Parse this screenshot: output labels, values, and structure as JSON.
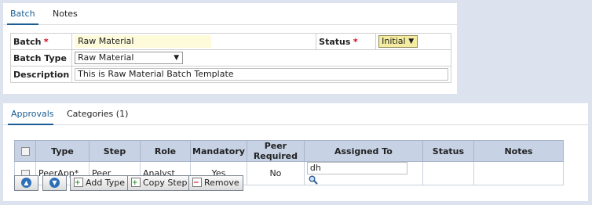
{
  "top_tabs": {
    "batch": "Batch",
    "notes": "Notes"
  },
  "batch_form": {
    "batch_label": "Batch",
    "batch_value": "Raw Material",
    "status_label": "Status",
    "status_value": "Initial",
    "batch_type_label": "Batch Type",
    "batch_type_value": "Raw Material",
    "description_label": "Description",
    "description_value": "This is Raw Material Batch Template",
    "required_marker": "*"
  },
  "bottom_tabs": {
    "approvals": "Approvals",
    "categories": "Categories (1)"
  },
  "approvals_table": {
    "columns": [
      "Type",
      "Step",
      "Role",
      "Mandatory",
      "Peer Required",
      "Assigned To",
      "Status",
      "Notes"
    ],
    "rows": [
      {
        "type": "PeerApp*",
        "step": "Peer",
        "role": "Analyst",
        "mandatory": "Yes",
        "peer_required": "No",
        "assigned_to": "dh",
        "status": "",
        "notes": ""
      }
    ]
  },
  "toolbar": {
    "move_up_icon": "up-arrow-circle-icon",
    "move_down_icon": "down-arrow-circle-icon",
    "add_type": "Add Type",
    "copy_step": "Copy Step",
    "remove": "Remove"
  },
  "colors": {
    "accent": "#1a5c93",
    "required": "#d0021b",
    "grid_header": "#c7d3e5",
    "page_bg": "#dde3ee",
    "highlight_field": "#fdfbd9",
    "status_select": "#f4eca0"
  }
}
